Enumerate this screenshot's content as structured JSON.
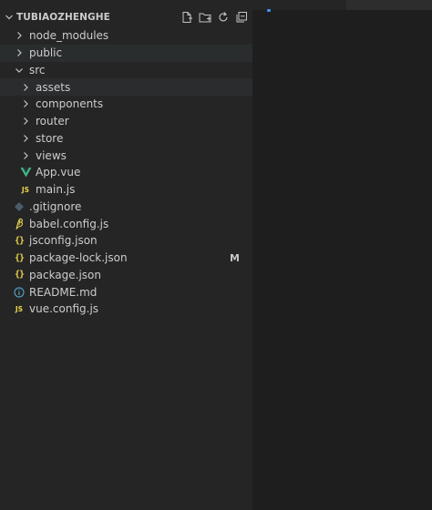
{
  "explorer": {
    "title": "TUBIAOZHENGHE",
    "actions": [
      "new-file-icon",
      "new-folder-icon",
      "refresh-icon",
      "collapse-all-icon"
    ],
    "items": [
      {
        "label": "node_modules",
        "type": "folder",
        "expanded": false,
        "level": 0
      },
      {
        "label": "public",
        "type": "folder",
        "expanded": false,
        "level": 0
      },
      {
        "label": "src",
        "type": "folder",
        "expanded": true,
        "level": 0
      },
      {
        "label": "assets",
        "type": "folder",
        "expanded": false,
        "level": 1
      },
      {
        "label": "components",
        "type": "folder",
        "expanded": false,
        "level": 1
      },
      {
        "label": "router",
        "type": "folder",
        "expanded": false,
        "level": 1
      },
      {
        "label": "store",
        "type": "folder",
        "expanded": false,
        "level": 1
      },
      {
        "label": "views",
        "type": "folder",
        "expanded": false,
        "level": 1
      },
      {
        "label": "App.vue",
        "type": "vue",
        "level": 1
      },
      {
        "label": "main.js",
        "type": "js",
        "level": 1
      },
      {
        "label": ".gitignore",
        "type": "git",
        "level": 0
      },
      {
        "label": "babel.config.js",
        "type": "babel",
        "level": 0
      },
      {
        "label": "jsconfig.json",
        "type": "json",
        "level": 0
      },
      {
        "label": "package-lock.json",
        "type": "json",
        "level": 0,
        "badge": "M"
      },
      {
        "label": "package.json",
        "type": "json",
        "level": 0
      },
      {
        "label": "README.md",
        "type": "info",
        "level": 0
      },
      {
        "label": "vue.config.js",
        "type": "vuejs",
        "level": 0
      }
    ],
    "js_icon_text": "JS",
    "json_icon_text": "{}"
  },
  "colors": {
    "sidebar_bg": "#252526",
    "editor_bg": "#1e1e1e",
    "hover_bg": "#2a2d2e",
    "vue_green": "#41b883",
    "js_yellow": "#e8d44d",
    "info_blue": "#519aba"
  }
}
